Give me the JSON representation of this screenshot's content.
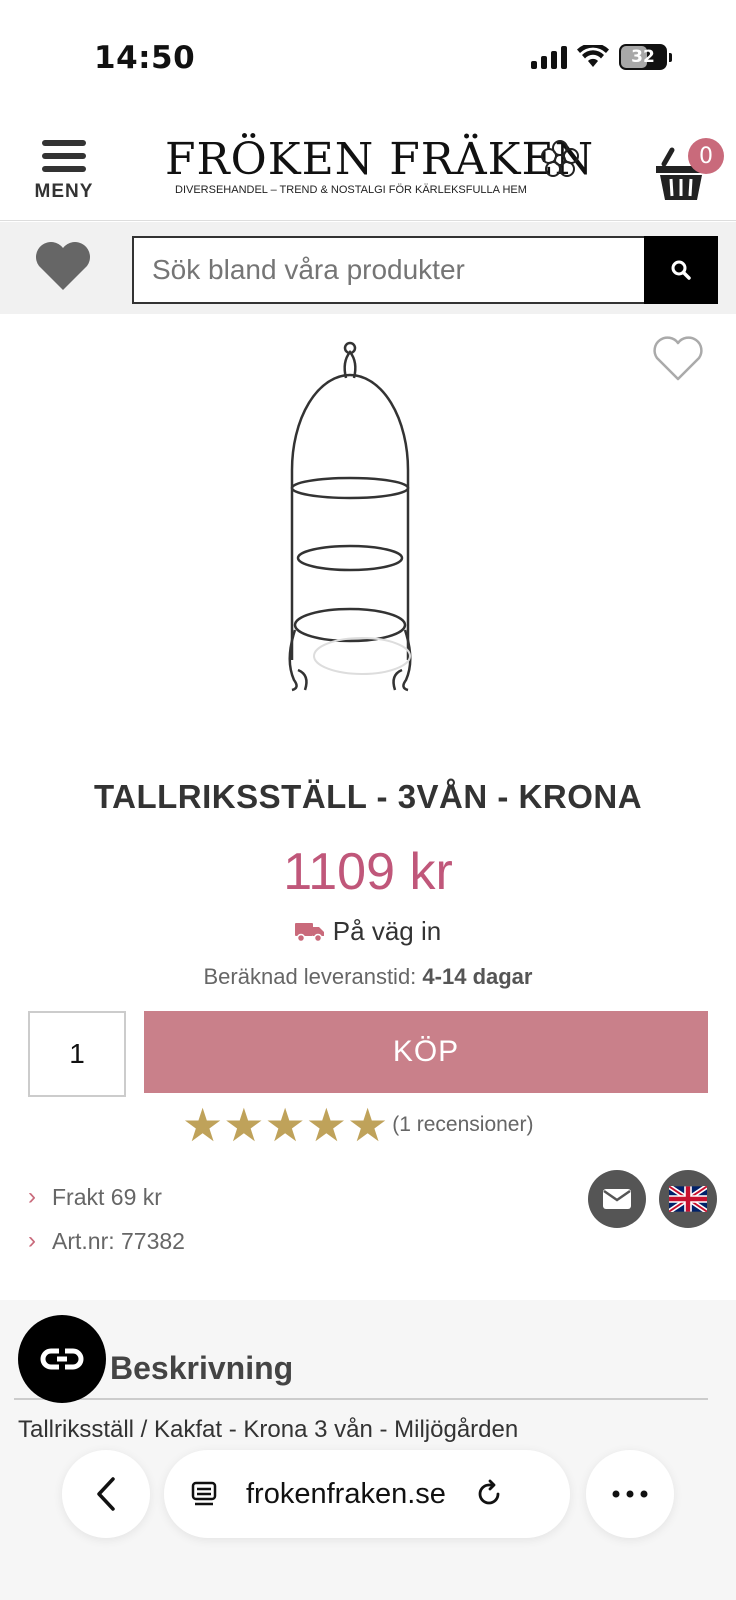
{
  "status_bar": {
    "time": "14:50",
    "battery": "32"
  },
  "header": {
    "menu_label": "MENY",
    "logo_text": "FRÖKEN FRÄKEN",
    "logo_tagline": "DIVERSEHANDEL – TREND & NOSTALGI FÖR KÄRLEKSFULLA HEM",
    "cart_count": "0"
  },
  "search": {
    "placeholder": "Sök bland våra produkter"
  },
  "product": {
    "title": "TALLRIKSSTÄLL - 3VÅN - KRONA",
    "price": "1109 kr",
    "stock_status": "På väg in",
    "delivery_label": "Beräknad leveranstid:",
    "delivery_value": "4-14 dagar",
    "quantity": "1",
    "buy_label": "KÖP",
    "rating": 5,
    "review_count": "(1 recensioner)",
    "shipping": "Frakt 69 kr",
    "article_number": "Art.nr: 77382"
  },
  "description": {
    "heading": "Beskrivning",
    "line1": "Tallriksställ / Kakfat - Krona 3 vån - Miljögården"
  },
  "browser": {
    "url": "frokenfraken.se"
  },
  "colors": {
    "accent": "#c96a7b",
    "price": "#c0577a",
    "buy_button": "#c9808a",
    "star": "#bfa25a"
  }
}
